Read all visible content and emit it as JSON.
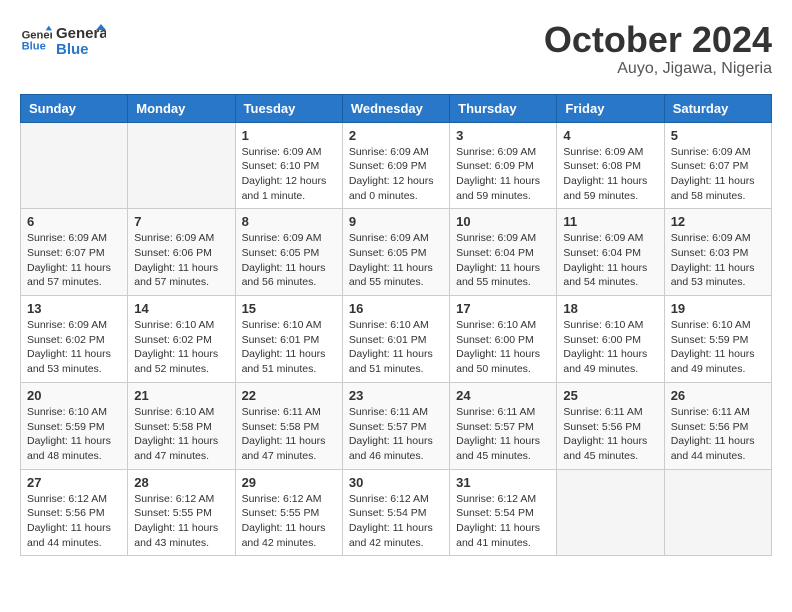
{
  "header": {
    "logo_line1": "General",
    "logo_line2": "Blue",
    "month": "October 2024",
    "location": "Auyo, Jigawa, Nigeria"
  },
  "weekdays": [
    "Sunday",
    "Monday",
    "Tuesday",
    "Wednesday",
    "Thursday",
    "Friday",
    "Saturday"
  ],
  "weeks": [
    [
      {
        "day": "",
        "sunrise": "",
        "sunset": "",
        "daylight": ""
      },
      {
        "day": "",
        "sunrise": "",
        "sunset": "",
        "daylight": ""
      },
      {
        "day": "1",
        "sunrise": "Sunrise: 6:09 AM",
        "sunset": "Sunset: 6:10 PM",
        "daylight": "Daylight: 12 hours and 1 minute."
      },
      {
        "day": "2",
        "sunrise": "Sunrise: 6:09 AM",
        "sunset": "Sunset: 6:09 PM",
        "daylight": "Daylight: 12 hours and 0 minutes."
      },
      {
        "day": "3",
        "sunrise": "Sunrise: 6:09 AM",
        "sunset": "Sunset: 6:09 PM",
        "daylight": "Daylight: 11 hours and 59 minutes."
      },
      {
        "day": "4",
        "sunrise": "Sunrise: 6:09 AM",
        "sunset": "Sunset: 6:08 PM",
        "daylight": "Daylight: 11 hours and 59 minutes."
      },
      {
        "day": "5",
        "sunrise": "Sunrise: 6:09 AM",
        "sunset": "Sunset: 6:07 PM",
        "daylight": "Daylight: 11 hours and 58 minutes."
      }
    ],
    [
      {
        "day": "6",
        "sunrise": "Sunrise: 6:09 AM",
        "sunset": "Sunset: 6:07 PM",
        "daylight": "Daylight: 11 hours and 57 minutes."
      },
      {
        "day": "7",
        "sunrise": "Sunrise: 6:09 AM",
        "sunset": "Sunset: 6:06 PM",
        "daylight": "Daylight: 11 hours and 57 minutes."
      },
      {
        "day": "8",
        "sunrise": "Sunrise: 6:09 AM",
        "sunset": "Sunset: 6:05 PM",
        "daylight": "Daylight: 11 hours and 56 minutes."
      },
      {
        "day": "9",
        "sunrise": "Sunrise: 6:09 AM",
        "sunset": "Sunset: 6:05 PM",
        "daylight": "Daylight: 11 hours and 55 minutes."
      },
      {
        "day": "10",
        "sunrise": "Sunrise: 6:09 AM",
        "sunset": "Sunset: 6:04 PM",
        "daylight": "Daylight: 11 hours and 55 minutes."
      },
      {
        "day": "11",
        "sunrise": "Sunrise: 6:09 AM",
        "sunset": "Sunset: 6:04 PM",
        "daylight": "Daylight: 11 hours and 54 minutes."
      },
      {
        "day": "12",
        "sunrise": "Sunrise: 6:09 AM",
        "sunset": "Sunset: 6:03 PM",
        "daylight": "Daylight: 11 hours and 53 minutes."
      }
    ],
    [
      {
        "day": "13",
        "sunrise": "Sunrise: 6:09 AM",
        "sunset": "Sunset: 6:02 PM",
        "daylight": "Daylight: 11 hours and 53 minutes."
      },
      {
        "day": "14",
        "sunrise": "Sunrise: 6:10 AM",
        "sunset": "Sunset: 6:02 PM",
        "daylight": "Daylight: 11 hours and 52 minutes."
      },
      {
        "day": "15",
        "sunrise": "Sunrise: 6:10 AM",
        "sunset": "Sunset: 6:01 PM",
        "daylight": "Daylight: 11 hours and 51 minutes."
      },
      {
        "day": "16",
        "sunrise": "Sunrise: 6:10 AM",
        "sunset": "Sunset: 6:01 PM",
        "daylight": "Daylight: 11 hours and 51 minutes."
      },
      {
        "day": "17",
        "sunrise": "Sunrise: 6:10 AM",
        "sunset": "Sunset: 6:00 PM",
        "daylight": "Daylight: 11 hours and 50 minutes."
      },
      {
        "day": "18",
        "sunrise": "Sunrise: 6:10 AM",
        "sunset": "Sunset: 6:00 PM",
        "daylight": "Daylight: 11 hours and 49 minutes."
      },
      {
        "day": "19",
        "sunrise": "Sunrise: 6:10 AM",
        "sunset": "Sunset: 5:59 PM",
        "daylight": "Daylight: 11 hours and 49 minutes."
      }
    ],
    [
      {
        "day": "20",
        "sunrise": "Sunrise: 6:10 AM",
        "sunset": "Sunset: 5:59 PM",
        "daylight": "Daylight: 11 hours and 48 minutes."
      },
      {
        "day": "21",
        "sunrise": "Sunrise: 6:10 AM",
        "sunset": "Sunset: 5:58 PM",
        "daylight": "Daylight: 11 hours and 47 minutes."
      },
      {
        "day": "22",
        "sunrise": "Sunrise: 6:11 AM",
        "sunset": "Sunset: 5:58 PM",
        "daylight": "Daylight: 11 hours and 47 minutes."
      },
      {
        "day": "23",
        "sunrise": "Sunrise: 6:11 AM",
        "sunset": "Sunset: 5:57 PM",
        "daylight": "Daylight: 11 hours and 46 minutes."
      },
      {
        "day": "24",
        "sunrise": "Sunrise: 6:11 AM",
        "sunset": "Sunset: 5:57 PM",
        "daylight": "Daylight: 11 hours and 45 minutes."
      },
      {
        "day": "25",
        "sunrise": "Sunrise: 6:11 AM",
        "sunset": "Sunset: 5:56 PM",
        "daylight": "Daylight: 11 hours and 45 minutes."
      },
      {
        "day": "26",
        "sunrise": "Sunrise: 6:11 AM",
        "sunset": "Sunset: 5:56 PM",
        "daylight": "Daylight: 11 hours and 44 minutes."
      }
    ],
    [
      {
        "day": "27",
        "sunrise": "Sunrise: 6:12 AM",
        "sunset": "Sunset: 5:56 PM",
        "daylight": "Daylight: 11 hours and 44 minutes."
      },
      {
        "day": "28",
        "sunrise": "Sunrise: 6:12 AM",
        "sunset": "Sunset: 5:55 PM",
        "daylight": "Daylight: 11 hours and 43 minutes."
      },
      {
        "day": "29",
        "sunrise": "Sunrise: 6:12 AM",
        "sunset": "Sunset: 5:55 PM",
        "daylight": "Daylight: 11 hours and 42 minutes."
      },
      {
        "day": "30",
        "sunrise": "Sunrise: 6:12 AM",
        "sunset": "Sunset: 5:54 PM",
        "daylight": "Daylight: 11 hours and 42 minutes."
      },
      {
        "day": "31",
        "sunrise": "Sunrise: 6:12 AM",
        "sunset": "Sunset: 5:54 PM",
        "daylight": "Daylight: 11 hours and 41 minutes."
      },
      {
        "day": "",
        "sunrise": "",
        "sunset": "",
        "daylight": ""
      },
      {
        "day": "",
        "sunrise": "",
        "sunset": "",
        "daylight": ""
      }
    ]
  ]
}
